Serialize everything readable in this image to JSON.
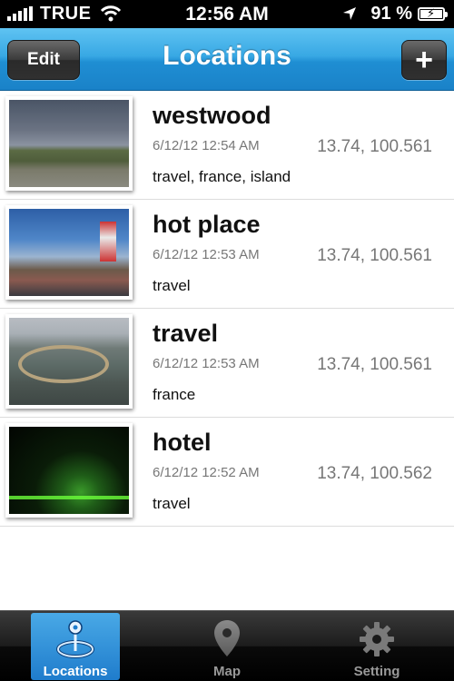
{
  "status_bar": {
    "carrier": "TRUE",
    "time": "12:56 AM",
    "battery_percent": "91 %",
    "battery_level": 0.91
  },
  "nav": {
    "title": "Locations",
    "edit_label": "Edit",
    "add_label": "+"
  },
  "locations": [
    {
      "name": "westwood",
      "date": "6/12/12 12:54 AM",
      "coords": "13.74, 100.561",
      "tags": "travel, france, island"
    },
    {
      "name": "hot place",
      "date": "6/12/12 12:53 AM",
      "coords": "13.74, 100.561",
      "tags": "travel"
    },
    {
      "name": "travel",
      "date": "6/12/12 12:53 AM",
      "coords": "13.74, 100.561",
      "tags": "france"
    },
    {
      "name": "hotel",
      "date": "6/12/12 12:52 AM",
      "coords": "13.74, 100.562",
      "tags": "travel"
    }
  ],
  "tabs": [
    {
      "label": "Locations",
      "icon": "location-target-icon",
      "active": true
    },
    {
      "label": "Map",
      "icon": "map-pin-icon",
      "active": false
    },
    {
      "label": "Setting",
      "icon": "gear-icon",
      "active": false
    }
  ],
  "colors": {
    "nav_blue": "#38a8e4",
    "tab_active_blue": "#1f7ccc"
  }
}
